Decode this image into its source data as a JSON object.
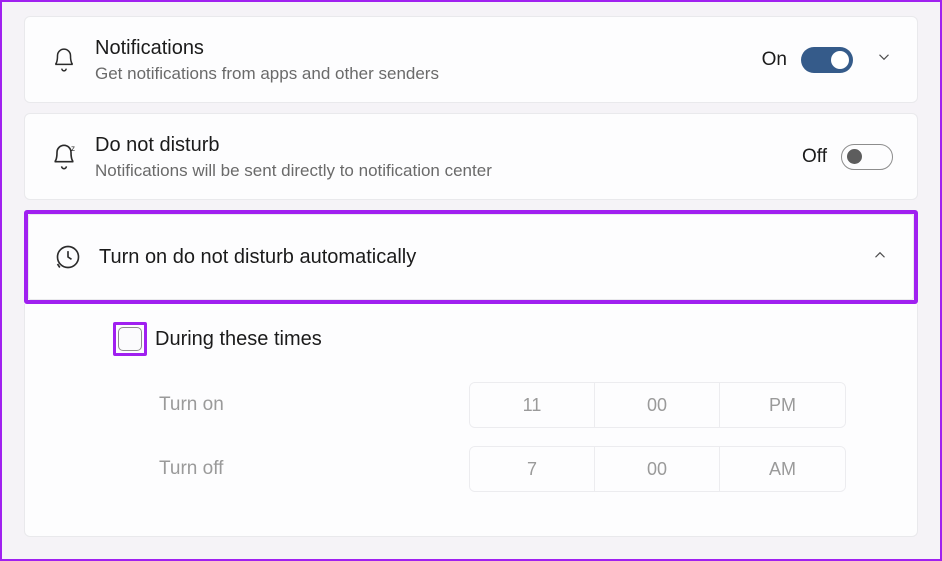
{
  "notifications": {
    "title": "Notifications",
    "subtitle": "Get notifications from apps and other senders",
    "stateLabel": "On",
    "toggleOn": true
  },
  "dnd": {
    "title": "Do not disturb",
    "subtitle": "Notifications will be sent directly to notification center",
    "stateLabel": "Off",
    "toggleOn": false
  },
  "autoDnd": {
    "title": "Turn on do not disturb automatically",
    "duringTimesLabel": "During these times",
    "turnOn": {
      "label": "Turn on",
      "hour": "11",
      "minute": "00",
      "ampm": "PM"
    },
    "turnOff": {
      "label": "Turn off",
      "hour": "7",
      "minute": "00",
      "ampm": "AM"
    }
  }
}
